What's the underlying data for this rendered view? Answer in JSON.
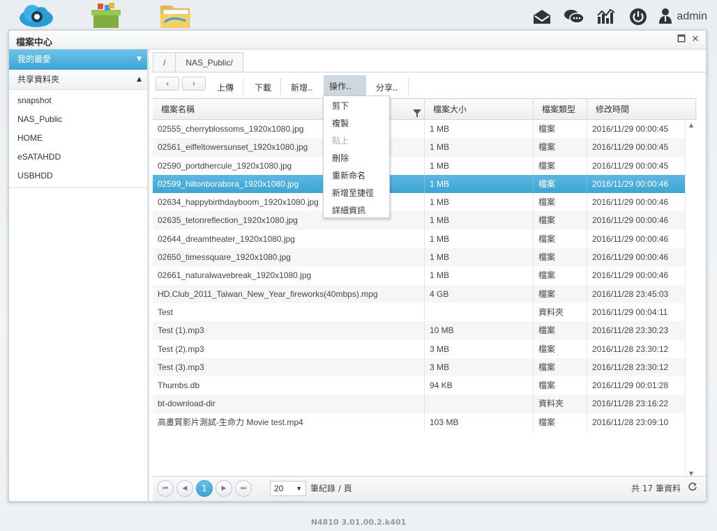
{
  "topbar": {
    "apps": [
      {
        "icon": "cloud-app-icon"
      },
      {
        "icon": "app-center-icon"
      },
      {
        "icon": "file-folder-app-icon"
      }
    ],
    "icons": [
      "mail-icon",
      "chat-icon",
      "activity-monitor-icon",
      "power-icon"
    ],
    "user": "admin"
  },
  "window": {
    "title": "檔案中心",
    "maximize": "🗖",
    "close": "✕"
  },
  "sidebar": {
    "favorites_label": "我的最愛",
    "favorites_arrow": "▼",
    "shared_label": "共享資料夾",
    "shared_arrow": "▲",
    "items": [
      {
        "label": "snapshot"
      },
      {
        "label": "NAS_Public"
      },
      {
        "label": "HOME"
      },
      {
        "label": "eSATAHDD"
      },
      {
        "label": "USBHDD"
      }
    ]
  },
  "breadcrumb": [
    "/",
    "NAS_Public/"
  ],
  "toolbar": {
    "back": "‹",
    "forward": "›",
    "upload": "上傳",
    "download": "下載",
    "new": "新增..",
    "actions": "操作..",
    "share": "分享.."
  },
  "menu": {
    "items": [
      {
        "label": "剪下",
        "disabled": false
      },
      {
        "label": "複製",
        "disabled": false
      },
      {
        "label": "貼上",
        "disabled": true
      },
      {
        "label": "刪除",
        "disabled": false
      },
      {
        "label": "重新命名",
        "disabled": false
      },
      {
        "label": "新增至捷徑",
        "disabled": false
      },
      {
        "label": "詳細資訊",
        "disabled": false
      }
    ]
  },
  "grid": {
    "columns": [
      "檔案名稱",
      "檔案大小",
      "檔案類型",
      "修改時間"
    ],
    "selected_index": 3,
    "rows": [
      {
        "name": "02555_cherryblossoms_1920x1080.jpg",
        "size": "1 MB",
        "type": "檔案",
        "mtime": "2016/11/29 00:00:45"
      },
      {
        "name": "02561_eiffeltowersunset_1920x1080.jpg",
        "size": "1 MB",
        "type": "檔案",
        "mtime": "2016/11/29 00:00:45"
      },
      {
        "name": "02590_portdhercule_1920x1080.jpg",
        "size": "1 MB",
        "type": "檔案",
        "mtime": "2016/11/29 00:00:45"
      },
      {
        "name": "02599_hiltonborabora_1920x1080.jpg",
        "size": "1 MB",
        "type": "檔案",
        "mtime": "2016/11/29 00:00:46"
      },
      {
        "name": "02634_happybirthdayboom_1920x1080.jpg",
        "size": "1 MB",
        "type": "檔案",
        "mtime": "2016/11/29 00:00:46"
      },
      {
        "name": "02635_tetonreflection_1920x1080.jpg",
        "size": "1 MB",
        "type": "檔案",
        "mtime": "2016/11/29 00:00:46"
      },
      {
        "name": "02644_dreamtheater_1920x1080.jpg",
        "size": "1 MB",
        "type": "檔案",
        "mtime": "2016/11/29 00:00:46"
      },
      {
        "name": "02650_timessquare_1920x1080.jpg",
        "size": "1 MB",
        "type": "檔案",
        "mtime": "2016/11/29 00:00:46"
      },
      {
        "name": "02661_naturalwavebreak_1920x1080.jpg",
        "size": "1 MB",
        "type": "檔案",
        "mtime": "2016/11/29 00:00:46"
      },
      {
        "name": "HD.Club_2011_Taiwan_New_Year_fireworks(40mbps).mpg",
        "size": "4 GB",
        "type": "檔案",
        "mtime": "2016/11/28 23:45:03"
      },
      {
        "name": "Test",
        "size": "",
        "type": "資料夾",
        "mtime": "2016/11/29 00:04:11"
      },
      {
        "name": "Test (1).mp3",
        "size": "10 MB",
        "type": "檔案",
        "mtime": "2016/11/28 23:30:23"
      },
      {
        "name": "Test (2).mp3",
        "size": "3 MB",
        "type": "檔案",
        "mtime": "2016/11/28 23:30:12"
      },
      {
        "name": "Test (3).mp3",
        "size": "3 MB",
        "type": "檔案",
        "mtime": "2016/11/28 23:30:12"
      },
      {
        "name": "Thumbs.db",
        "size": "94 KB",
        "type": "檔案",
        "mtime": "2016/11/29 00:01:28"
      },
      {
        "name": "bt-download-dir",
        "size": "",
        "type": "資料夾",
        "mtime": "2016/11/28 23:16:22"
      },
      {
        "name": "高畫質影片測試-生命力 Movie test.mp4",
        "size": "103 MB",
        "type": "檔案",
        "mtime": "2016/11/28 23:09:10"
      }
    ]
  },
  "pager": {
    "first": "⏮",
    "prev": "◀",
    "current_page": "1",
    "next": "▶",
    "last": "⏭",
    "page_size": "20",
    "page_size_arrow": "▼",
    "per_page_label": "筆紀錄 / 頁",
    "total_label": "共 17 筆資料"
  },
  "footer": "N4810   3.01.00.2.k401",
  "colors": {
    "accent": "#3ea4d3",
    "selection": "#4fb0dc"
  }
}
